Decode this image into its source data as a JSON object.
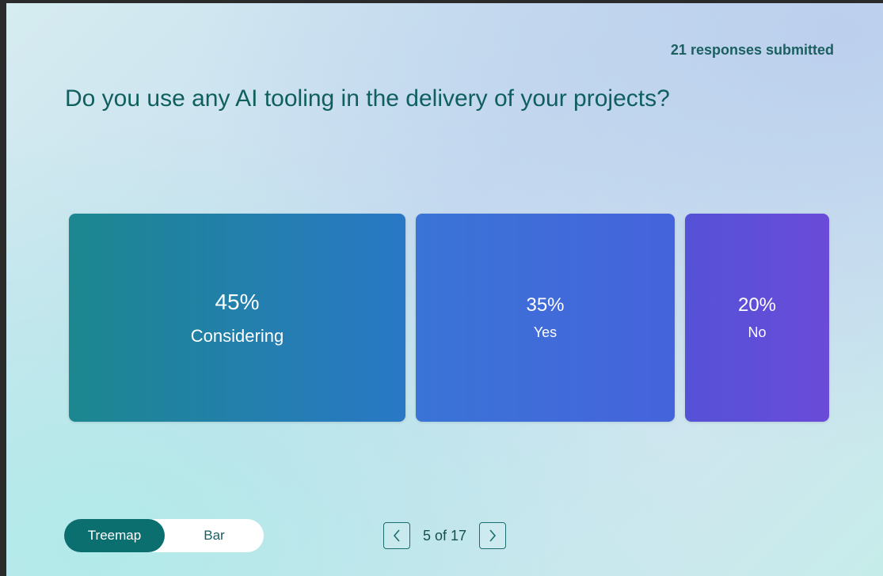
{
  "header": {
    "responses": "21 responses submitted",
    "question": "Do you use any AI tooling in the delivery of your projects?"
  },
  "chart_data": {
    "type": "treemap",
    "categories": [
      "Considering",
      "Yes",
      "No"
    ],
    "values": [
      45,
      35,
      20
    ],
    "labels": [
      "45%",
      "35%",
      "20%"
    ],
    "colors": [
      "#1c878f",
      "#3a74d6",
      "#5f4fd8"
    ]
  },
  "view_toggle": {
    "treemap_label": "Treemap",
    "bar_label": "Bar",
    "selected": "Treemap"
  },
  "pager": {
    "text": "5 of 17",
    "prev_icon": "chevron-left-icon",
    "next_icon": "chevron-right-icon"
  }
}
